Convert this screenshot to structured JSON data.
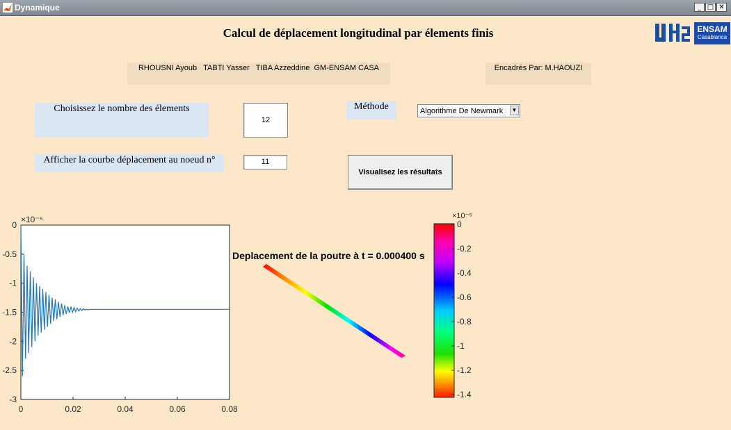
{
  "window": {
    "title": "Dynamique",
    "minimize": "_",
    "maximize": "□",
    "close": "✕"
  },
  "header": {
    "title": "Calcul de déplacement longitudinal par élements finis",
    "logo_left_text": "UH2",
    "logo_right_line1": "ENSAM",
    "logo_right_line2": "Casablanca"
  },
  "authors": "RHOUSNI Ayoub   TABTI Yasser   TIBA Azzeddine  GM-ENSAM CASA",
  "supervisor": "Encadrés Par: M.HAOUZI",
  "form": {
    "elements_label": "Choisissez le nombre des élements",
    "elements_value": "12",
    "node_label": "Afficher la courbe déplacement au noeud n°",
    "node_value": "11",
    "method_label": "Méthode",
    "method_selected": "Algorithme De Newmark",
    "visualize_button": "Visualisez les résultats"
  },
  "plot": {
    "exponent": "×10⁻⁵",
    "y_ticks": [
      "0",
      "-0.5",
      "-1",
      "-1.5",
      "-2",
      "-2.5",
      "-3"
    ],
    "x_ticks": [
      "0",
      "0.02",
      "0.04",
      "0.06",
      "0.08"
    ],
    "line_color": "#1f77b4"
  },
  "beam": {
    "title": "Deplacement de la poutre à t = 0.000400 s"
  },
  "colorbar": {
    "exponent": "×10⁻⁵",
    "ticks": [
      "0",
      "-0.2",
      "-0.4",
      "-0.6",
      "-0.8",
      "-1",
      "-1.2",
      "-1.4"
    ]
  },
  "chart_data": {
    "type": "line",
    "title": "",
    "xlabel": "",
    "ylabel": "",
    "xlim": [
      0,
      0.08
    ],
    "ylim": [
      -3e-05,
      0
    ],
    "description_series": [
      {
        "name": "",
        "x_note": "time",
        "x": [
          0,
          0.0006,
          0.0012,
          0.0018,
          0.0024,
          0.003,
          0.0036,
          0.0042,
          0.0048,
          0.0054,
          0.006,
          0.0066,
          0.0072,
          0.0078,
          0.0084,
          0.009,
          0.0096,
          0.0102,
          0.0108,
          0.0114,
          0.012,
          0.0126,
          0.0132,
          0.0138,
          0.0144,
          0.015,
          0.0156,
          0.0162,
          0.0168,
          0.0174,
          0.018,
          0.0186,
          0.0192,
          0.0198,
          0.0204,
          0.021,
          0.0216,
          0.0222,
          0.0228,
          0.0234,
          0.024,
          0.0246,
          0.0252,
          0.0258,
          0.0264,
          0.027,
          0.028,
          0.03,
          0.04,
          0.05,
          0.06,
          0.07,
          0.08
        ],
        "y": [
          0,
          -2.6e-05,
          -5e-06,
          -2.3e-05,
          -7e-06,
          -2.2e-05,
          -8e-06,
          -2.1e-05,
          -9e-06,
          -2e-05,
          -1e-05,
          -1.9e-05,
          -1.05e-05,
          -1.85e-05,
          -1.1e-05,
          -1.8e-05,
          -1.15e-05,
          -1.75e-05,
          -1.2e-05,
          -1.7e-05,
          -1.25e-05,
          -1.65e-05,
          -1.28e-05,
          -1.62e-05,
          -1.32e-05,
          -1.58e-05,
          -1.35e-05,
          -1.55e-05,
          -1.38e-05,
          -1.53e-05,
          -1.4e-05,
          -1.51e-05,
          -1.41e-05,
          -1.5e-05,
          -1.42e-05,
          -1.49e-05,
          -1.43e-05,
          -1.48e-05,
          -1.44e-05,
          -1.47e-05,
          -1.44e-05,
          -1.46e-05,
          -1.45e-05,
          -1.46e-05,
          -1.45e-05,
          -1.45e-05,
          -1.45e-05,
          -1.45e-05,
          -1.45e-05,
          -1.45e-05,
          -1.45e-05,
          -1.45e-05,
          -1.45e-05
        ]
      }
    ]
  }
}
